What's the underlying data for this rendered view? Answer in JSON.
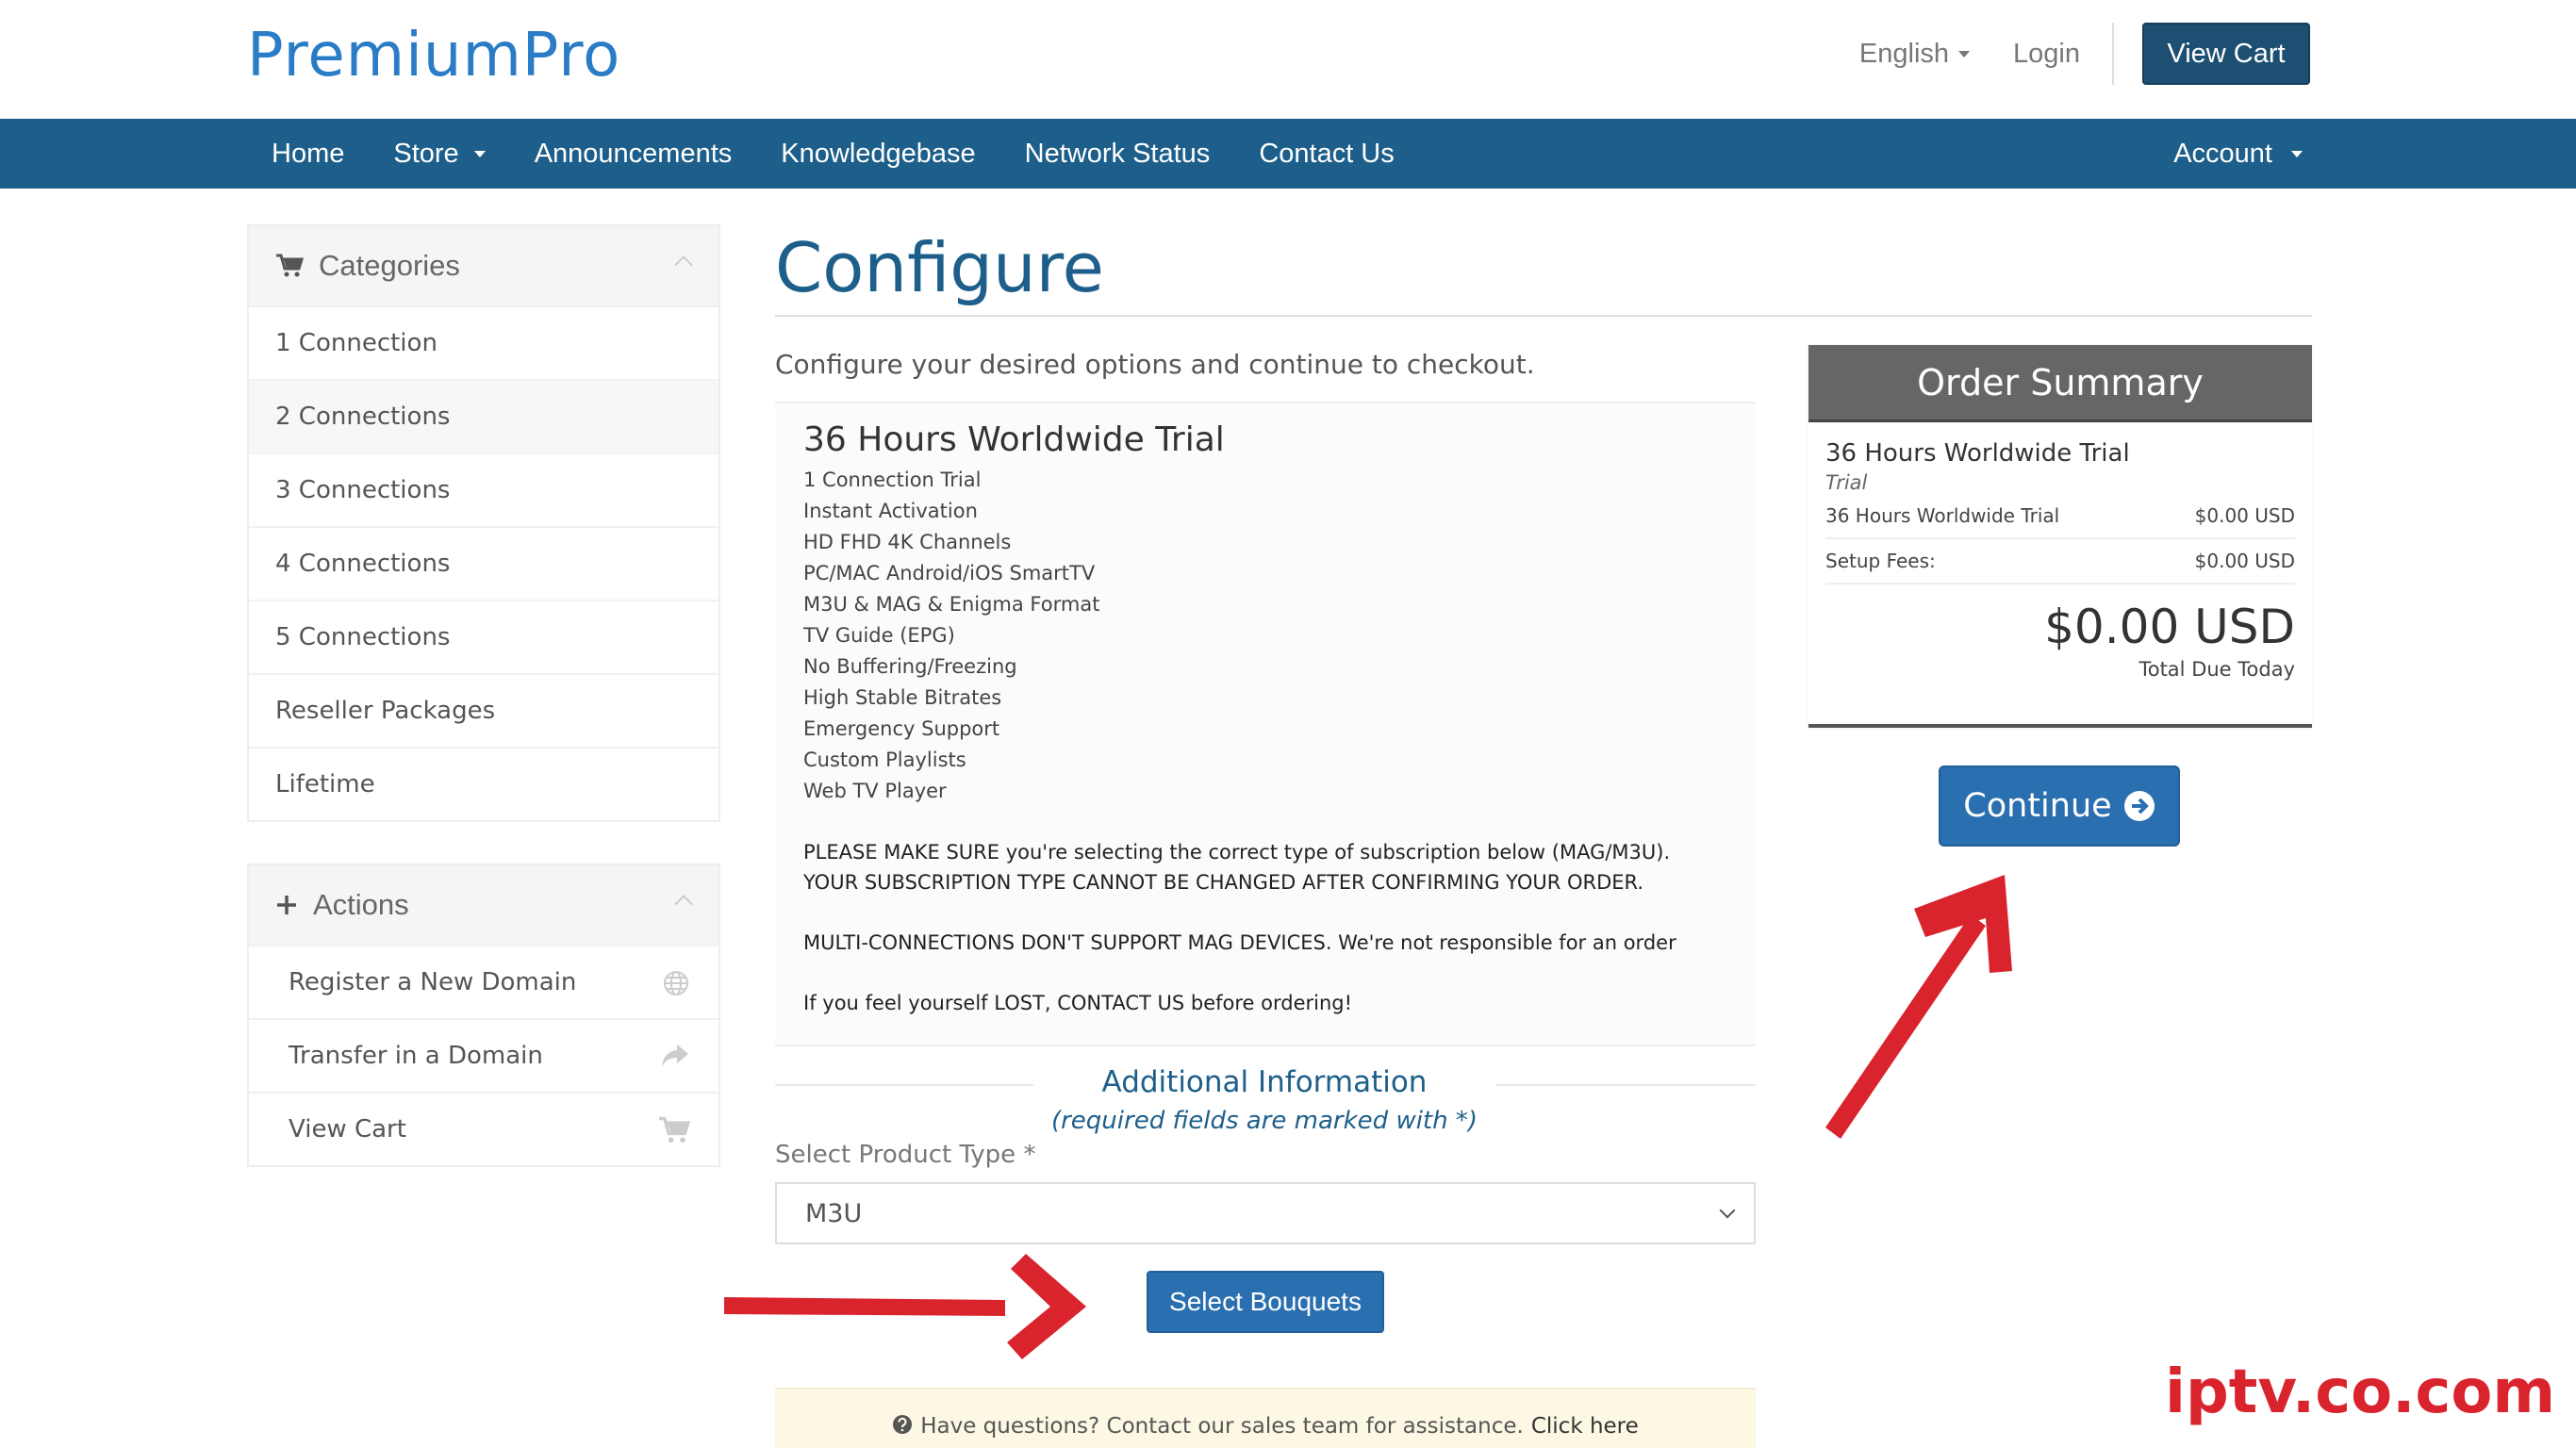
{
  "header": {
    "logo": "PremiumPro",
    "language": "English",
    "login": "Login",
    "view_cart": "View Cart"
  },
  "nav": {
    "items": [
      "Home",
      "Store",
      "Announcements",
      "Knowledgebase",
      "Network Status",
      "Contact Us"
    ],
    "account": "Account"
  },
  "sidebar": {
    "categories": {
      "title": "Categories",
      "items": [
        "1 Connection",
        "2 Connections",
        "3 Connections",
        "4 Connections",
        "5 Connections",
        "Reseller Packages",
        "Lifetime"
      ]
    },
    "actions": {
      "title": "Actions",
      "items": [
        "Register a New Domain",
        "Transfer in a Domain",
        "View Cart"
      ]
    }
  },
  "main": {
    "title": "Configure",
    "intro": "Configure your desired options and continue to checkout.",
    "product": {
      "name": "36 Hours Worldwide Trial",
      "features": [
        "1 Connection Trial",
        "Instant Activation",
        "HD FHD 4K Channels",
        "PC/MAC Android/iOS SmartTV",
        "M3U & MAG & Enigma Format",
        "TV Guide (EPG)",
        "No Buffering/Freezing",
        "High Stable Bitrates",
        "Emergency Support",
        "Custom Playlists",
        "Web TV Player"
      ],
      "notice1": "PLEASE MAKE SURE you're selecting the correct type of subscription below (MAG/M3U).",
      "notice2": "YOUR SUBSCRIPTION TYPE CANNOT BE CHANGED AFTER CONFIRMING YOUR ORDER.",
      "notice3": "MULTI-CONNECTIONS DON'T SUPPORT MAG DEVICES. We're not responsible for an order",
      "notice4": "If you feel yourself LOST, CONTACT US before ordering!"
    },
    "additional": {
      "title": "Additional Information",
      "subtitle": "(required fields are marked with *)",
      "field_label": "Select Product Type *",
      "field_value": "M3U",
      "bouquets_button": "Select Bouquets"
    },
    "help": {
      "text": "Have questions? Contact our sales team for assistance.",
      "link": "Click here"
    }
  },
  "summary": {
    "title": "Order Summary",
    "product_name": "36 Hours Worldwide Trial",
    "group": "Trial",
    "line_label": "36 Hours Worldwide Trial",
    "line_value": "$0.00 USD",
    "setup_label": "Setup Fees:",
    "setup_value": "$0.00 USD",
    "total": "$0.00 USD",
    "total_label": "Total Due Today",
    "continue": "Continue"
  },
  "watermark": "iptv.co.com",
  "colors": {
    "brand": "#1d5f8a",
    "button": "#2a6fb0",
    "annotation_arrow": "#d9232d"
  }
}
